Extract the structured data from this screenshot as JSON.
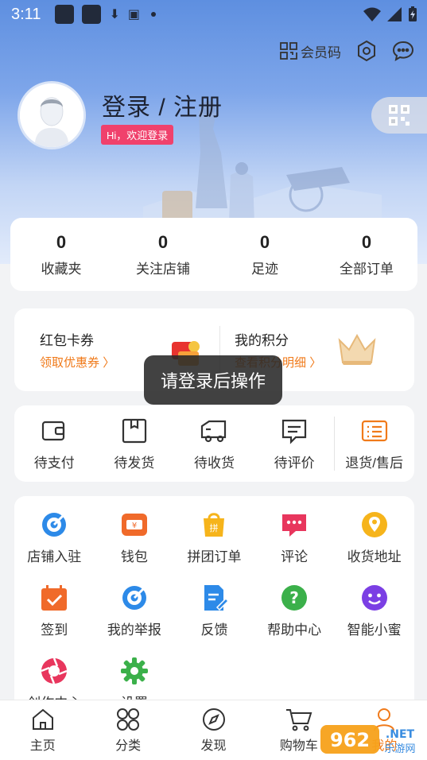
{
  "status_bar": {
    "time": "3:11"
  },
  "header": {
    "member_code_label": "会员码",
    "login_title": "登录 / 注册",
    "welcome_badge": "Hi，欢迎登录"
  },
  "stats": [
    {
      "value": "0",
      "label": "收藏夹"
    },
    {
      "value": "0",
      "label": "关注店铺"
    },
    {
      "value": "0",
      "label": "足迹"
    },
    {
      "value": "0",
      "label": "全部订单"
    }
  ],
  "promo": {
    "coupon_title": "红包卡券",
    "coupon_sub": "领取优惠券",
    "points_title": "我的积分",
    "points_sub": "查看积分明细"
  },
  "toast": "请登录后操作",
  "orders": [
    {
      "label": "待支付",
      "icon": "wallet-icon"
    },
    {
      "label": "待发货",
      "icon": "box-icon"
    },
    {
      "label": "待收货",
      "icon": "truck-icon"
    },
    {
      "label": "待评价",
      "icon": "comment-icon"
    },
    {
      "label": "退货/售后",
      "icon": "return-icon"
    }
  ],
  "services": [
    {
      "label": "店铺入驻",
      "icon": "target-icon"
    },
    {
      "label": "钱包",
      "icon": "wallet-icon"
    },
    {
      "label": "拼团订单",
      "icon": "group-buy-icon"
    },
    {
      "label": "评论",
      "icon": "chat-icon"
    },
    {
      "label": "收货地址",
      "icon": "location-icon"
    },
    {
      "label": "签到",
      "icon": "calendar-check-icon"
    },
    {
      "label": "我的举报",
      "icon": "target-icon"
    },
    {
      "label": "反馈",
      "icon": "edit-doc-icon"
    },
    {
      "label": "帮助中心",
      "icon": "help-icon"
    },
    {
      "label": "智能小蜜",
      "icon": "assistant-icon"
    },
    {
      "label": "创作中心",
      "icon": "aperture-icon"
    },
    {
      "label": "设置",
      "icon": "gear-icon"
    }
  ],
  "tabbar": [
    {
      "label": "主页",
      "icon": "home-icon"
    },
    {
      "label": "分类",
      "icon": "category-icon"
    },
    {
      "label": "发现",
      "icon": "compass-icon"
    },
    {
      "label": "购物车",
      "icon": "cart-icon"
    },
    {
      "label": "我的",
      "icon": "user-icon"
    }
  ],
  "watermark": {
    "brand": "962",
    "suffix": ".NET",
    "tagline": "乐游网"
  },
  "colors": {
    "accent": "#f07a1a",
    "badge": "#f0416c",
    "hero": "#7ea6ea"
  }
}
